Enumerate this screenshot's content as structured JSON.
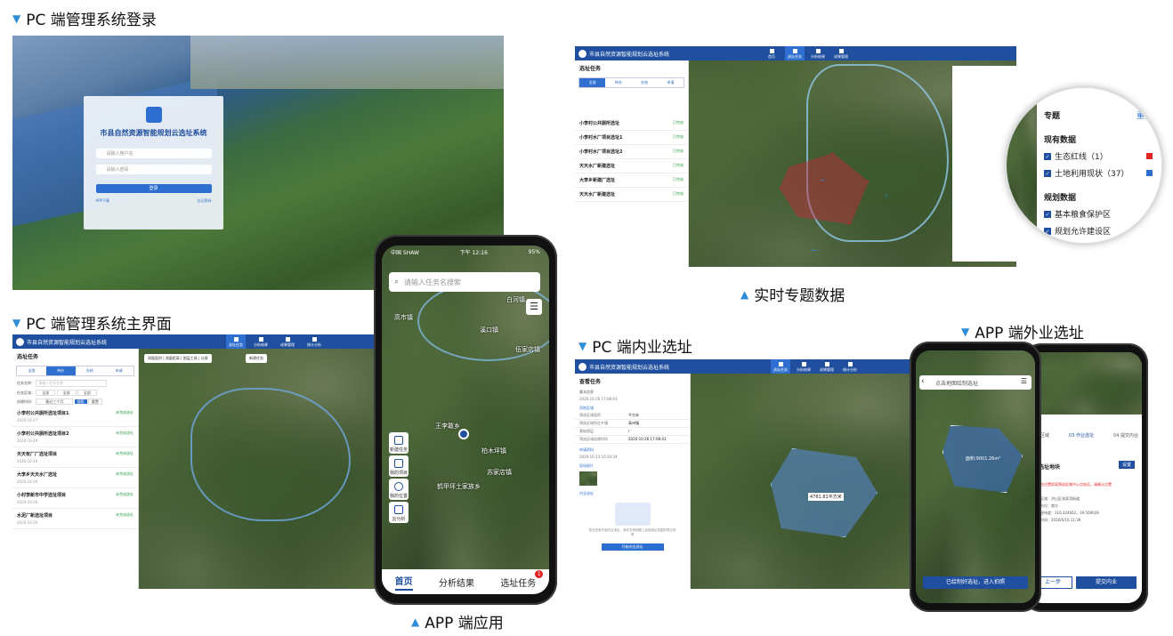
{
  "captions": {
    "pc_login": "PC 端管理系统登录",
    "pc_main": "PC 端管理系统主界面",
    "app": "APP 端应用",
    "realtime": "实时专题数据",
    "pc_inner": "PC 端内业选址",
    "app_outer": "APP 端外业选址"
  },
  "login": {
    "system_title": "市县自然资源智能规划云选址系统",
    "username_placeholder": "请输入用户名",
    "password_placeholder": "请输入密码",
    "login_button": "登录",
    "app_download": "APP下载",
    "forgot": "忘记密码"
  },
  "pc_main": {
    "app_title": "市县自然资源智能规划云选址系统",
    "nav": [
      "选址任务",
      "分析结果",
      "成果管理",
      "统计分析"
    ],
    "sidebar_title": "选址任务",
    "tabs": [
      "全部",
      "待办",
      "办结",
      "申请"
    ],
    "filters": {
      "name_label": "任务名称：",
      "name_placeholder": "请输入任务名称",
      "region_label": "任务区域：",
      "region_v1": "全部",
      "region_v2": "全部",
      "region_v3": "全部",
      "time_label": "创建时间：",
      "time_v": "最近三个月",
      "search": "搜索",
      "reset": "重置"
    },
    "tasks": [
      {
        "name": "小李村公共厕所选址项目1",
        "status": "未完成选址",
        "meta": "2020-10-27"
      },
      {
        "name": "小李村公共厕所选址项目2",
        "status": "未完成选址",
        "meta": "2020-10-29"
      },
      {
        "name": "天天有厂厂选址项目",
        "status": "未完成选址",
        "meta": "2020-10-26"
      },
      {
        "name": "大李乡天天水厂选址",
        "status": "未完成选址",
        "meta": "2020-10-26"
      },
      {
        "name": "小村李新市中学选址项目",
        "status": "未完成选址",
        "meta": "2020-10-26"
      },
      {
        "name": "水泥厂新选址项目",
        "status": "未完成选址",
        "meta": "2020-10-26"
      }
    ],
    "toolbar": [
      "测量面积",
      "测量距离",
      "图层工具",
      "分屏",
      "新建任务"
    ]
  },
  "app": {
    "carrier": "中国 SHAW",
    "time": "下午 12:16",
    "battery": "95%",
    "search_placeholder": "请输入任务名搜索",
    "map_labels": [
      "高市镇",
      "白河镇",
      "溪口镇",
      "伍家店镇",
      "王李敢乡",
      "柏木坪镇",
      "鹤甲坪土家族乡",
      "苏家店镇"
    ],
    "side_buttons": [
      "新建任务",
      "我的项目",
      "我的位置",
      "云分析"
    ],
    "bottom": [
      "首页",
      "分析结果",
      "选址任务"
    ],
    "badge": "1"
  },
  "realtime": {
    "app_title": "市县自然资源智能规划云选址系统",
    "nav": [
      "首页",
      "选址任务",
      "分析结果",
      "成果管理"
    ],
    "sidebar_title": "选址任务",
    "tabs": [
      "全部",
      "待办",
      "办结",
      "申请"
    ],
    "tasks": [
      {
        "name": "小李村公共厕所选址",
        "status": "已完成"
      },
      {
        "name": "小李村水厂项目选址1",
        "status": "已完成"
      },
      {
        "name": "小李村水厂项目选址2",
        "status": "已完成"
      },
      {
        "name": "天天水厂新建选址",
        "status": "已完成"
      },
      {
        "name": "大李乡新建厂选址",
        "status": "已完成"
      },
      {
        "name": "天天水厂新建选址",
        "status": "已完成"
      }
    ],
    "zoom": {
      "title": "专题",
      "reset": "重置",
      "group1": "现有数据",
      "items1": [
        {
          "label": "生态红线（1）",
          "color": "#e02424"
        },
        {
          "label": "土地利用现状（37）",
          "color": "#2c6fd0"
        }
      ],
      "group2": "规划数据",
      "items2": [
        {
          "label": "基本粮食保护区",
          "color": "#2ea84a"
        },
        {
          "label": "规划允许建设区",
          "color": "#9a3fb8"
        }
      ]
    }
  },
  "pc_inner": {
    "app_title": "市县自然资源智能规划云选址系统",
    "nav": [
      "选址任务",
      "分析结果",
      "成果管理",
      "统计分析"
    ],
    "panel_title": "查看任务",
    "section1": "基本信息",
    "created": "2020-10-26 17:08:43",
    "section2": "用地区域",
    "rows": [
      [
        "预选区域面积",
        "平方米"
      ],
      [
        "预选区域所在乡镇",
        "高州镇"
      ],
      [
        "基础图层",
        "/"
      ],
      [
        "预选区域创建时间",
        "2020-10-26 17:08:43"
      ]
    ],
    "section3": "申请资料",
    "review_time": "2020-10-23 10:34:34",
    "section4": "现场照片",
    "section5": "内业选址",
    "empty_text": "您还没有开始内业选址，请在右侧地图上绘制选址范围并提交申请",
    "start_button": "开始内业选址",
    "area_label": "4761.81平方米"
  },
  "app_outer": {
    "header": "点击地图绘制选址",
    "area": "面积:9001.26m²",
    "steps": [
      "预选区域",
      "作业选址",
      "提交内业"
    ],
    "step_nums": [
      "03",
      "04"
    ],
    "sheet_title": "新选址地块",
    "sheet_btn": "设置",
    "warning": "您所在位置距离预选区域中心点较远，请确认位置",
    "info": [
      "所在区域：洪山区张家湾街道",
      "所在方位：南方",
      "坐标经纬度：116.324662，39.569028",
      "选址时间：2020/6/10 11:39"
    ],
    "confirm": "已绘制好选址，进入拍照",
    "prev": "上一步",
    "submit": "提交内业"
  }
}
